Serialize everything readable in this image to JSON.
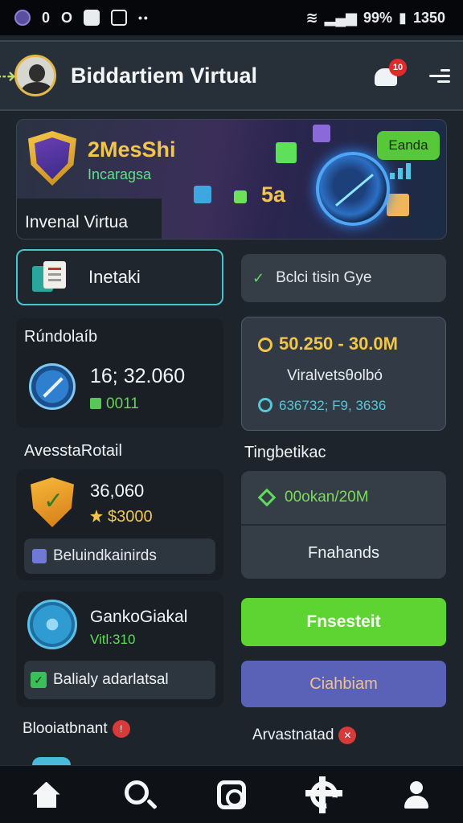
{
  "status_bar": {
    "left_glyph_1": "0",
    "left_glyph_2": "O",
    "battery": "99%",
    "time": "1350"
  },
  "header": {
    "title": "Biddartiem Virtual",
    "notification_count": "10"
  },
  "hero": {
    "title": "2MesShi",
    "subtitle": "Incaragsa",
    "caption": "Invenal Virtua",
    "badge": "Eanda",
    "number": "5a"
  },
  "quick_actions": {
    "primary_label": "Inetaki",
    "secondary_label": "Bclci tisin Gye"
  },
  "card_a": {
    "section_title": "Rúndolaíb",
    "value": "16; 32.060",
    "sub": "0011"
  },
  "card_b": {
    "range": "50.250 - 30.0M",
    "label": "Viralvetsθolbó",
    "sub": "636732; F9, 3636"
  },
  "section_2": {
    "left_title": "AvesstaRotail",
    "right_title": "Tingbetikac"
  },
  "card_c": {
    "value": "36,060",
    "sub": "$3000",
    "row_label": "Beluindkainirds"
  },
  "card_d": {
    "top_label": "00okan/20M",
    "bottom_label": "Fnahands"
  },
  "card_e": {
    "title": "GankoGiakal",
    "sub": "Vitl:310",
    "row_label": "Balialy adarlatsal"
  },
  "buttons": {
    "green_label": "Fnsesteit",
    "purple_label": "Ciahbiam"
  },
  "footer_labels": {
    "left": "Blooiatbnant",
    "left_badge": "!",
    "right": "Arvastnatad",
    "right_badge": "✕"
  },
  "bottom_nav": [
    "home-icon",
    "search-icon",
    "camera-icon",
    "settings-icon",
    "profile-icon"
  ]
}
